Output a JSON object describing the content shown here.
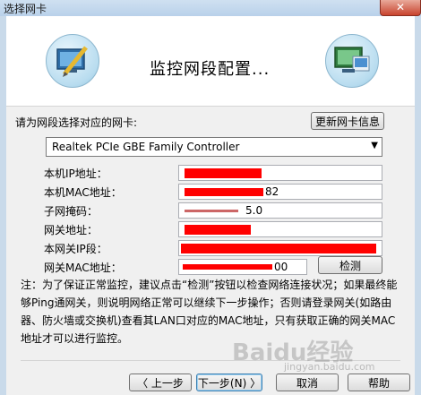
{
  "window": {
    "title": "选择网卡",
    "close_glyph": "✕"
  },
  "header": {
    "heading": "监控网段配置..."
  },
  "nic": {
    "prompt": "请为网段选择对应的网卡:",
    "update_button": "更新网卡信息",
    "selected": "Realtek PCIe GBE Family Controller"
  },
  "fields": {
    "ip": {
      "label": "本机IP地址：",
      "value": ""
    },
    "mac": {
      "label": "本机MAC地址：",
      "value": "82"
    },
    "mask": {
      "label": "子网掩码：",
      "value": "5.0"
    },
    "gateway": {
      "label": "网关地址：",
      "value": ""
    },
    "gateway_segment": {
      "label": "本网关IP段：",
      "value": ""
    },
    "gateway_mac": {
      "label": "网关MAC地址：",
      "value": "00",
      "detect_button": "检测"
    }
  },
  "note": "注：为了保证正常监控，建议点击“检测”按钮以检查网络连接状况；如果最终能够Ping通网关，则说明网络正常可以继续下一步操作；否则请登录网关(如路由器、防火墙或交换机)查看其LAN口对应的MAC地址，只有获取正确的网关MAC地址才可以进行监控。",
  "buttons": {
    "prev": "〈 上一步(B)",
    "next": "下一步(N) 〉",
    "cancel": "取消",
    "help": "帮助"
  },
  "watermark": {
    "brand": "Baidu经验",
    "url": "jingyan.baidu.com"
  }
}
